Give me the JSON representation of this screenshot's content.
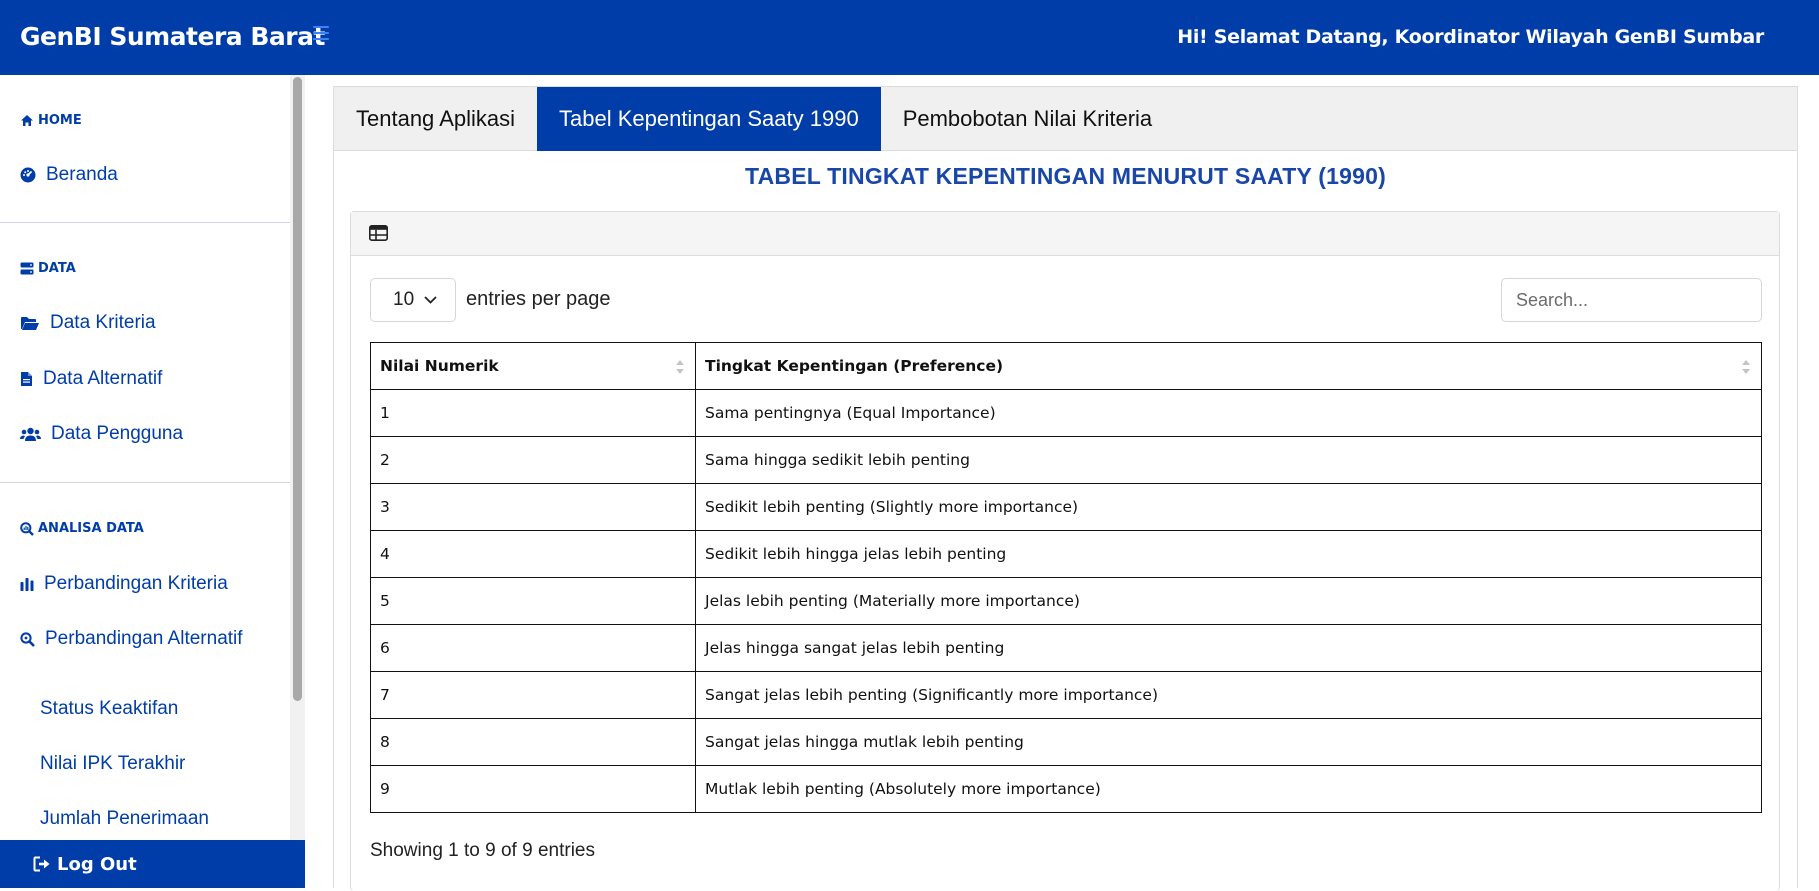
{
  "app": {
    "brand": "GenBI Sumatera Barat",
    "greeting": "Hi! Selamat Datang, Koordinator Wilayah GenBI Sumbar"
  },
  "sidebar": {
    "sections": [
      {
        "heading": "HOME",
        "items": [
          "Beranda"
        ]
      },
      {
        "heading": "DATA",
        "items": [
          "Data Kriteria",
          "Data Alternatif",
          "Data Pengguna"
        ]
      },
      {
        "heading": "ANALISA DATA",
        "items": [
          "Perbandingan Kriteria",
          "Perbandingan Alternatif"
        ]
      }
    ],
    "subitems": [
      "Status Keaktifan",
      "Nilai IPK Terakhir",
      "Jumlah Penerimaan"
    ],
    "logout": "Log Out"
  },
  "tabs": [
    "Tentang Aplikasi",
    "Tabel Kepentingan Saaty 1990",
    "Pembobotan Nilai Kriteria"
  ],
  "active_tab": 1,
  "main": {
    "title": "TABEL TINGKAT KEPENTINGAN MENURUT SAATY (1990)",
    "per_page_value": "10",
    "per_page_label": "entries per page",
    "search_placeholder": "Search...",
    "showing": "Showing 1 to 9 of 9 entries"
  },
  "table": {
    "headers": [
      "Nilai Numerik",
      "Tingkat Kepentingan (Preference)"
    ],
    "rows": [
      [
        "1",
        "Sama pentingnya (Equal Importance)"
      ],
      [
        "2",
        "Sama hingga sedikit lebih penting"
      ],
      [
        "3",
        "Sedikit lebih penting (Slightly more importance)"
      ],
      [
        "4",
        "Sedikit lebih hingga jelas lebih penting"
      ],
      [
        "5",
        "Jelas lebih penting (Materially more importance)"
      ],
      [
        "6",
        "Jelas hingga sangat jelas lebih penting"
      ],
      [
        "7",
        "Sangat jelas lebih penting (Significantly more importance)"
      ],
      [
        "8",
        "Sangat jelas hingga mutlak lebih penting"
      ],
      [
        "9",
        "Mutlak lebih penting (Absolutely more importance)"
      ]
    ]
  },
  "colors": {
    "primary": "#003da8",
    "title": "#1947a8"
  }
}
